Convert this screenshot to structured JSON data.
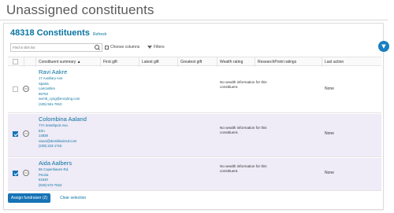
{
  "page": {
    "title": "Unassigned constituents"
  },
  "header": {
    "count_label": "48318 Constituents",
    "refresh_label": "Refresh"
  },
  "toolbar": {
    "search_placeholder": "Find in this list",
    "choose_columns_label": "Choose columns",
    "filters_label": "Filters"
  },
  "grid": {
    "columns": [
      "Constituent summary ▲",
      "First gift",
      "Latest gift",
      "Greatest gift",
      "Wealth rating",
      "ResearchPoint ratings",
      "Last action"
    ],
    "rows": [
      {
        "selected": false,
        "name": "Ravi Aakre",
        "address_lines": [
          "17 Auxiliary Ave.",
          "Sparta",
          "Lancashire",
          "65753",
          "wxmb_cyng@encyting.com",
          "(435) 561-7810"
        ],
        "wealth_rating": "No wealth information for this constituent.",
        "last_action": "None"
      },
      {
        "selected": true,
        "name": "Colombina Aaland",
        "address_lines": [
          "77A Smethport Ave.",
          "Erin",
          "14838",
          "rauvs@demilitarized.com",
          "(239) 223-1715"
        ],
        "wealth_rating": "No wealth information for this constituent.",
        "last_action": "None"
      },
      {
        "selected": true,
        "name": "Aida Aalbers",
        "address_lines": [
          "55 Copenhaven Rd.",
          "Peoria",
          "61640",
          "(818) 572-7624"
        ],
        "wealth_rating": "No wealth information for this constituent.",
        "last_action": "None"
      }
    ]
  },
  "footer": {
    "assign_label": "Assign fundraiser (2)",
    "clear_label": "Clear selection"
  },
  "colors": {
    "accent": "#1773b6",
    "link": "#0974a1",
    "selected_row": "#efebf7"
  }
}
